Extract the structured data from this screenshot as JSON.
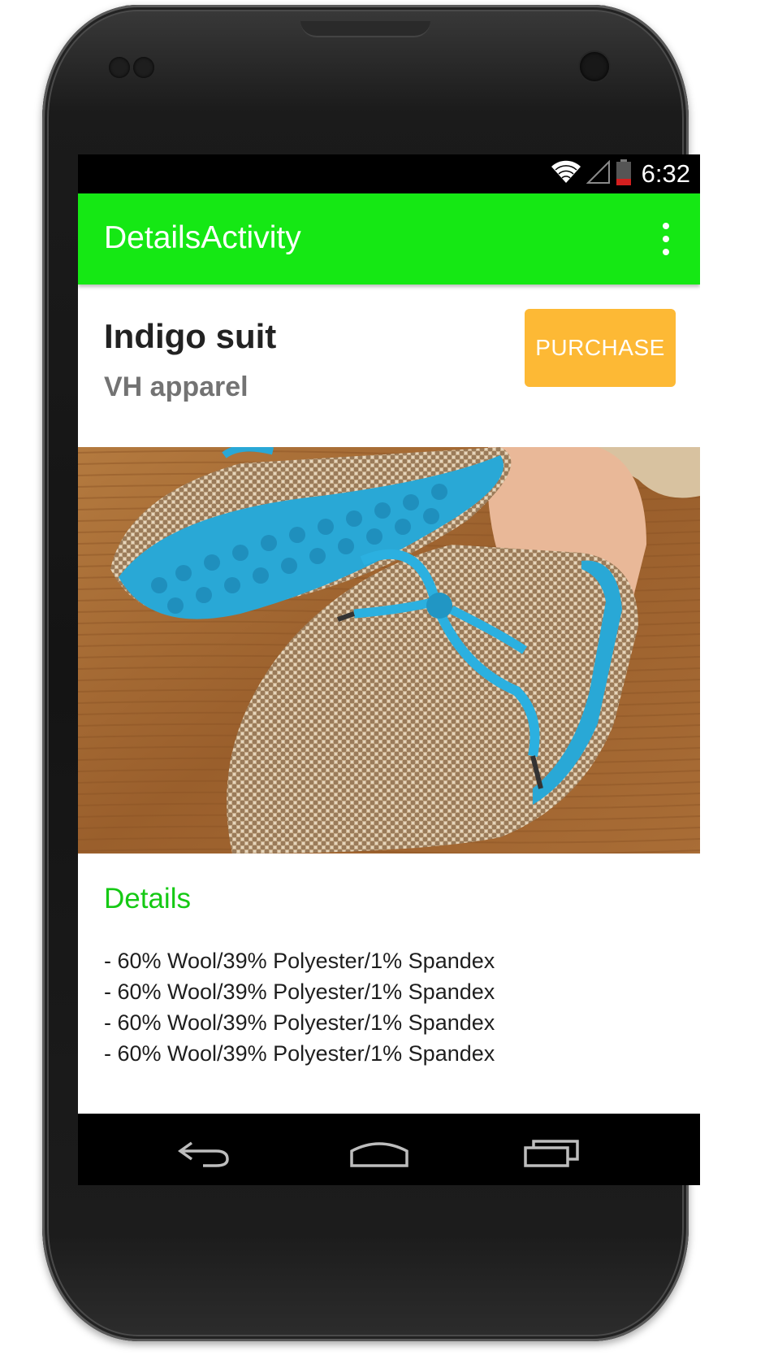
{
  "status_bar": {
    "time": "6:32",
    "icons": [
      "wifi-icon",
      "cell-signal-icon",
      "battery-icon"
    ]
  },
  "app_bar": {
    "title": "DetailsActivity",
    "menu_icon": "overflow-menu-icon"
  },
  "product": {
    "title": "Indigo suit",
    "brand": "VH apparel",
    "purchase_label": "PURCHASE"
  },
  "details": {
    "heading": "Details",
    "items": [
      "- 60% Wool/39% Polyester/1% Spandex",
      "- 60% Wool/39% Polyester/1% Spandex",
      "- 60% Wool/39% Polyester/1% Spandex",
      "- 60% Wool/39% Polyester/1% Spandex"
    ]
  },
  "nav_bar": {
    "icons": [
      "back-icon",
      "home-icon",
      "recents-icon"
    ]
  },
  "colors": {
    "app_bar": "#15e814",
    "accent_text": "#15c914",
    "purchase_button": "#fdb935"
  }
}
